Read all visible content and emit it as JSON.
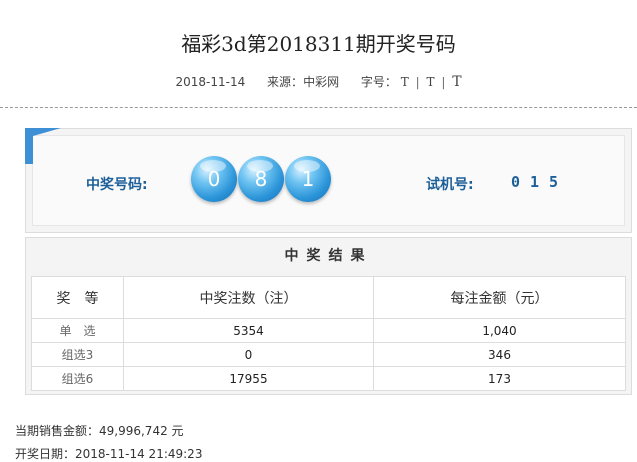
{
  "page": {
    "title": "福彩3d第2018311期开奖号码",
    "date": "2018-11-14",
    "source_label": "来源：",
    "source_value": "中彩网",
    "font_label": "字号：",
    "font_options": [
      "T",
      "T",
      "T"
    ],
    "font_separator": "|"
  },
  "draw": {
    "win_label": "中奖号码:",
    "balls": [
      "0",
      "8",
      "1"
    ],
    "test_label": "试机号:",
    "test_numbers": "015",
    "ball_color": "#2b94d8",
    "accent_color": "#1d5f99"
  },
  "results": {
    "title": "中奖结果",
    "headers": [
      "奖　等",
      "中奖注数（注）",
      "每注金额（元）"
    ],
    "rows": [
      {
        "level": "单　选",
        "count": "5354",
        "amount": "1,040"
      },
      {
        "level": "组选3",
        "count": "0",
        "amount": "346"
      },
      {
        "level": "组选6",
        "count": "17955",
        "amount": "173"
      }
    ]
  },
  "footer": {
    "sales": "当期销售金额：49,996,742 元",
    "draw_date": "开奖日期：2018-11-14 21:49:23"
  }
}
